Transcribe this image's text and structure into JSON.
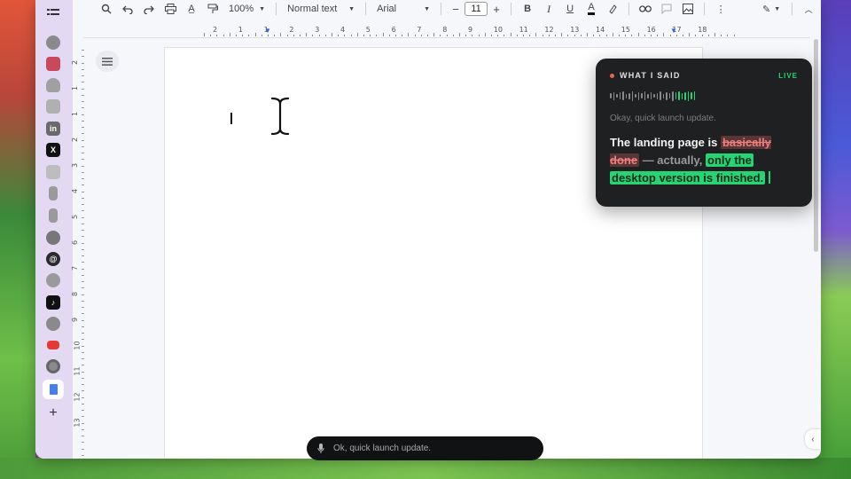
{
  "toolbar": {
    "zoom": "100%",
    "style": "Normal text",
    "font": "Arial",
    "font_size": "11",
    "minus": "−",
    "plus": "+"
  },
  "ruler": {
    "horizontal": [
      "2",
      "1",
      "1",
      "2",
      "3",
      "4",
      "5",
      "6",
      "7",
      "8",
      "9",
      "10",
      "11",
      "12",
      "13",
      "14",
      "15",
      "16",
      "17",
      "18"
    ],
    "vertical": [
      "2",
      "1",
      "1",
      "2",
      "3",
      "4",
      "5",
      "6",
      "7",
      "8",
      "9",
      "10",
      "11",
      "12",
      "13"
    ]
  },
  "transcript": {
    "title": "WHAT I SAID",
    "status": "LIVE",
    "previous": "Okay, quick launch update.",
    "line_prefix": "The landing page is",
    "struck": "basically done",
    "aside": "— actually,",
    "highlight_1": "only the",
    "highlight_2": "desktop version is finished."
  },
  "dictation": {
    "text": "Ok, quick launch update."
  },
  "colors": {
    "accent_green": "#27d475",
    "strike_red": "#ee7f7f",
    "sidebar_bg": "#e3d9f2",
    "panel_bg": "#1f2021"
  },
  "sidebar": {
    "icons": [
      "list-icon",
      "globe-icon",
      "app-icon",
      "cloud-icon",
      "app-icon",
      "linkedin-icon",
      "x-icon",
      "app-icon",
      "app-icon",
      "app-icon",
      "app-icon",
      "threads-icon",
      "whatsapp-icon",
      "tiktok-icon",
      "globe-icon",
      "youtube-icon",
      "chrome-icon",
      "docs-icon",
      "plus-icon"
    ]
  }
}
